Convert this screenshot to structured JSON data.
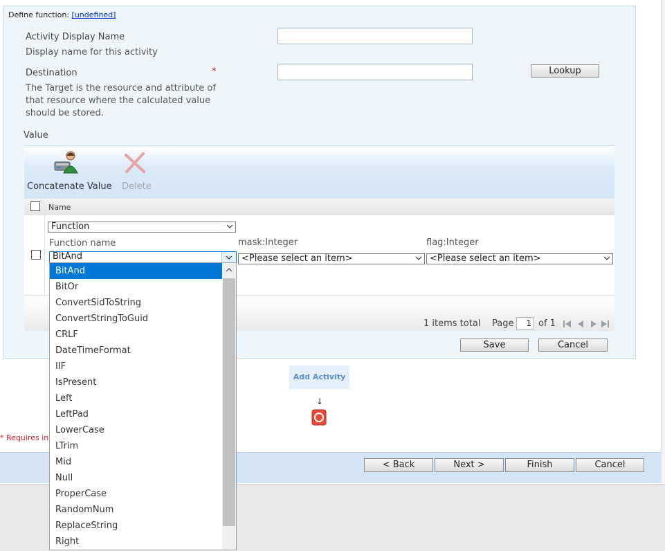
{
  "define_function": {
    "label": "Define function:",
    "link": "[undefined]"
  },
  "activity_display_name": {
    "label": "Activity Display Name",
    "description": "Display name for this activity",
    "value": ""
  },
  "destination": {
    "label": "Destination",
    "required_marker": "*",
    "description": [
      "The Target is the resource and attribute of",
      "that resource where the calculated value",
      "should be stored."
    ],
    "value": "",
    "lookup_button": "Lookup"
  },
  "value_section": {
    "label": "Value"
  },
  "toolbar": {
    "concatenate_label": "Concatenate Value",
    "delete_label": "Delete"
  },
  "grid": {
    "header_name": "Name",
    "row": {
      "type_select": "Function",
      "function_name_label": "Function name",
      "function_name_value": "BitAnd",
      "mask_label": "mask:Integer",
      "mask_value": "<Please select an item>",
      "flag_label": "flag:Integer",
      "flag_value": "<Please select an item>"
    }
  },
  "pager": {
    "items_total": "1 items total",
    "page_label": "Page",
    "page_value": "1",
    "of_label": "of 1"
  },
  "form_buttons": {
    "save": "Save",
    "cancel": "Cancel"
  },
  "add_activity": "Add Activity",
  "arrow": "↓",
  "requires_input": "* Requires inp",
  "wizard_buttons": {
    "back": "< Back",
    "next": "Next >",
    "finish": "Finish",
    "cancel": "Cancel"
  },
  "dropdown_options": [
    "BitAnd",
    "BitOr",
    "ConvertSidToString",
    "ConvertStringToGuid",
    "CRLF",
    "DateTimeFormat",
    "IIF",
    "IsPresent",
    "Left",
    "LeftPad",
    "LowerCase",
    "LTrim",
    "Mid",
    "Null",
    "ProperCase",
    "RandomNum",
    "ReplaceString",
    "Right"
  ],
  "colors": {
    "accent": "#0078d7",
    "required": "#e02020",
    "panel_bg": "#eef5fb"
  }
}
